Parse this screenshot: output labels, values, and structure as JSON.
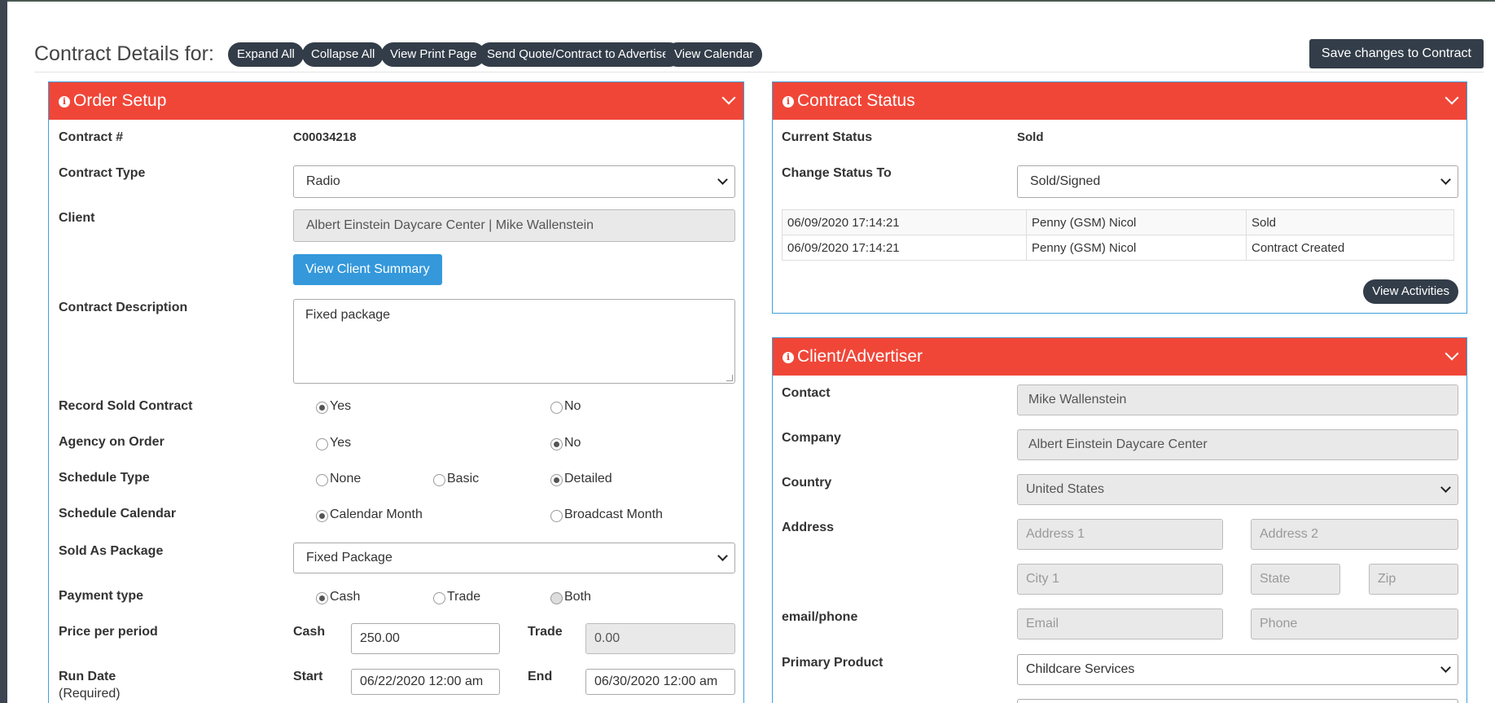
{
  "header": {
    "title": "Contract Details for:",
    "buttons": [
      "Expand All",
      "Collapse All",
      "View Print Page",
      "Send Quote/Contract to Advertiser",
      "View Calendar"
    ],
    "save_label": "Save changes to Contract"
  },
  "order_setup": {
    "title": "Order Setup",
    "contract_num_label": "Contract #",
    "contract_num": "C00034218",
    "contract_type_label": "Contract Type",
    "contract_type": "Radio",
    "client_label": "Client",
    "client": "Albert Einstein Daycare Center | Mike Wallenstein",
    "view_client_summary": "View Client Summary",
    "description_label": "Contract Description",
    "description": "Fixed package",
    "record_sold_label": "Record Sold Contract",
    "agency_label": "Agency on Order",
    "yes": "Yes",
    "no": "No",
    "schedule_type_label": "Schedule Type",
    "schedule_none": "None",
    "schedule_basic": "Basic",
    "schedule_detailed": "Detailed",
    "schedule_calendar_label": "Schedule Calendar",
    "calendar_month": "Calendar Month",
    "broadcast_month": "Broadcast Month",
    "sold_as_package_label": "Sold As Package",
    "sold_as_package": "Fixed Package",
    "payment_type_label": "Payment type",
    "pay_cash": "Cash",
    "pay_trade": "Trade",
    "pay_both": "Both",
    "price_label": "Price per period",
    "cash_label": "Cash",
    "cash_value": "250.00",
    "trade_label": "Trade",
    "trade_value": "0.00",
    "run_date_label": "Run Date",
    "run_date_required": "(Required)",
    "start_label": "Start",
    "start_value": "06/22/2020 12:00 am",
    "end_label": "End",
    "end_value": "06/30/2020 12:00 am"
  },
  "contract_status": {
    "title": "Contract Status",
    "current_label": "Current Status",
    "current_value": "Sold",
    "change_label": "Change Status To",
    "change_value": "Sold/Signed",
    "history": [
      {
        "date": "06/09/2020 17:14:21",
        "user": "Penny (GSM) Nicol",
        "status": "Sold"
      },
      {
        "date": "06/09/2020 17:14:21",
        "user": "Penny (GSM) Nicol",
        "status": "Contract Created"
      }
    ],
    "view_activities": "View Activities"
  },
  "client_advertiser": {
    "title": "Client/Advertiser",
    "contact_label": "Contact",
    "contact": "Mike Wallenstein",
    "company_label": "Company",
    "company": "Albert Einstein Daycare Center",
    "country_label": "Country",
    "country": "United States",
    "address_label": "Address",
    "address1_ph": "Address 1",
    "address2_ph": "Address 2",
    "city_ph": "City 1",
    "state_ph": "State",
    "zip_ph": "Zip",
    "email_phone_label": "email/phone",
    "email_ph": "Email",
    "phone_ph": "Phone",
    "primary_product_label": "Primary Product",
    "primary_product": "Childcare Services"
  }
}
